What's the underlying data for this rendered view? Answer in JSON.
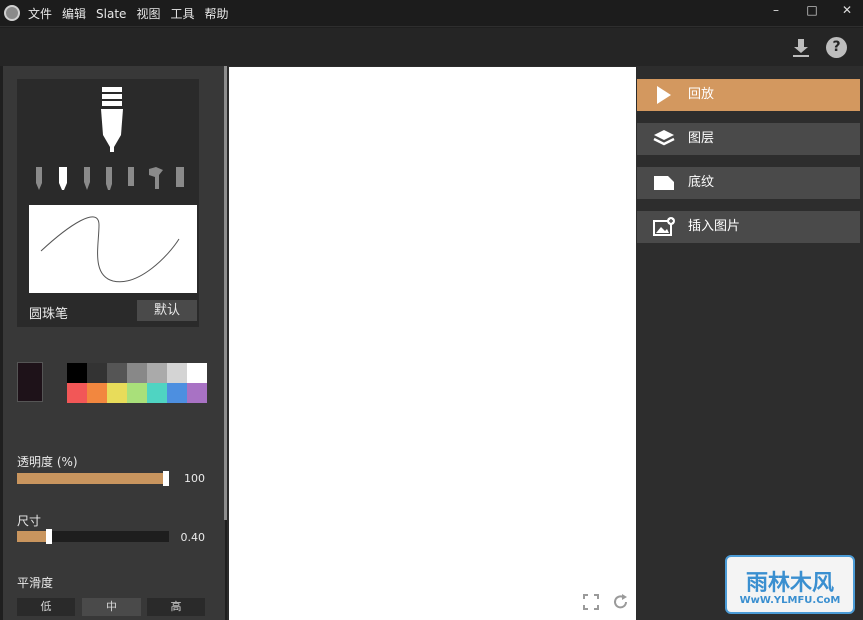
{
  "menu": {
    "items": [
      "文件",
      "编辑",
      "Slate",
      "视图",
      "工具",
      "帮助"
    ]
  },
  "window_controls": {
    "minimize": "–",
    "maximize": "□",
    "close": "✕"
  },
  "toolbar": {
    "download_icon": "download-icon",
    "help_label": "?"
  },
  "brush": {
    "name": "圆珠笔",
    "default_label": "默认"
  },
  "colors": {
    "accent": "#c9955e",
    "current": "#1e1219",
    "palette": [
      "#000000",
      "#333333",
      "#555555",
      "#888888",
      "#aaaaaa",
      "#d4d4d4",
      "#ffffff",
      "#f25757",
      "#f2873f",
      "#e8dc5a",
      "#a9e07a",
      "#4fd4c2",
      "#4d8fe0",
      "#a872c4"
    ]
  },
  "opacity": {
    "label": "透明度 (%)",
    "value": "100",
    "fraction": 1.0
  },
  "size": {
    "label": "尺寸",
    "value": "0.40",
    "fraction": 0.2
  },
  "smoothing": {
    "label": "平滑度",
    "options": [
      "低",
      "中",
      "高"
    ],
    "selected": "中"
  },
  "right_panel": {
    "items": [
      {
        "label": "回放",
        "icon": "play-icon",
        "active": true
      },
      {
        "label": "图层",
        "icon": "layers-icon",
        "active": false
      },
      {
        "label": "底纹",
        "icon": "page-icon",
        "active": false
      },
      {
        "label": "插入图片",
        "icon": "insert-image-icon",
        "active": false
      }
    ]
  },
  "watermark": {
    "top": "雨林木风",
    "bottom": "WwW.YLMFU.CoM"
  }
}
